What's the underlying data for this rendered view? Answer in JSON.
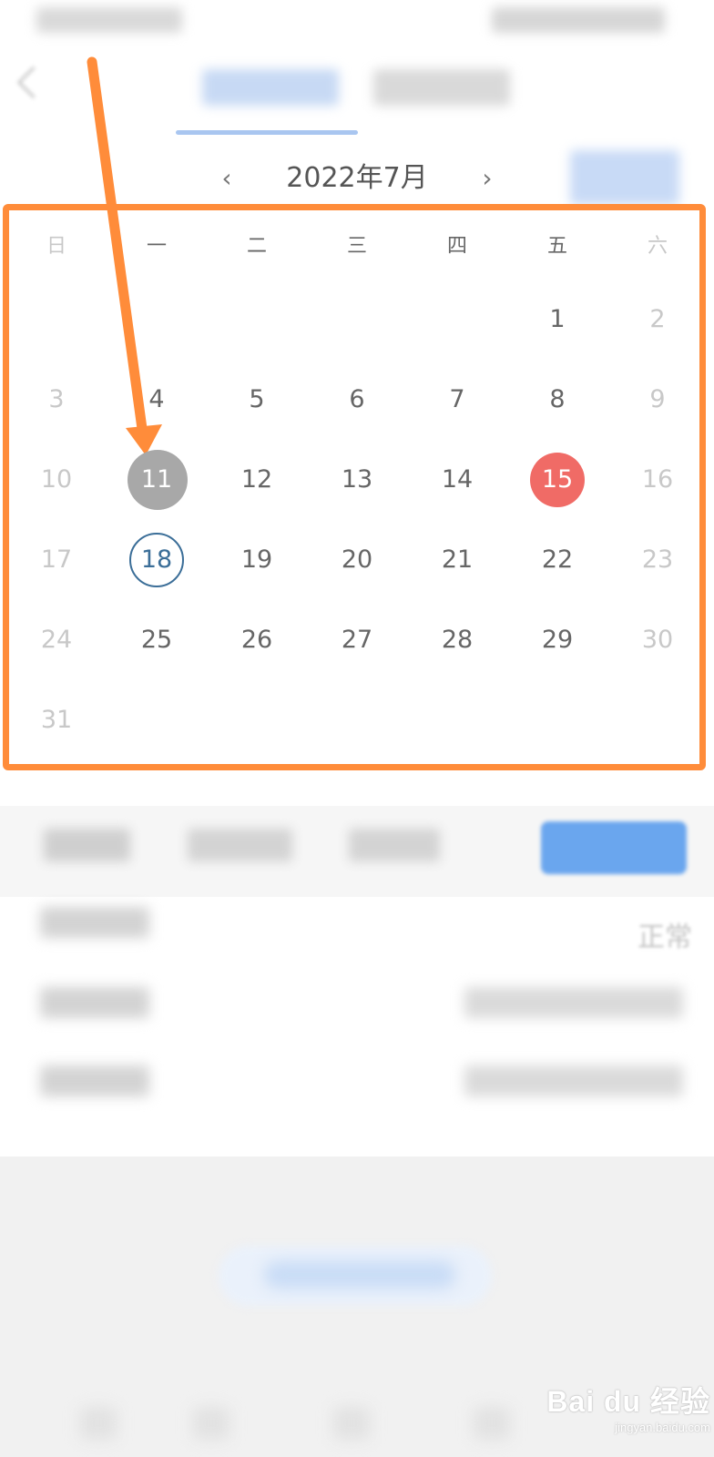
{
  "calendar": {
    "title": "2022年7月",
    "prev_icon": "‹",
    "next_icon": "›",
    "weekdays": [
      "日",
      "一",
      "二",
      "三",
      "四",
      "五",
      "六"
    ],
    "weeks": [
      [
        "",
        "",
        "",
        "",
        "",
        "1",
        "2"
      ],
      [
        "3",
        "4",
        "5",
        "6",
        "7",
        "8",
        "9"
      ],
      [
        "10",
        "11",
        "12",
        "13",
        "14",
        "15",
        "16"
      ],
      [
        "17",
        "18",
        "19",
        "20",
        "21",
        "22",
        "23"
      ],
      [
        "24",
        "25",
        "26",
        "27",
        "28",
        "29",
        "30"
      ],
      [
        "31",
        "",
        "",
        "",
        "",
        "",
        ""
      ]
    ],
    "selected_day": "11",
    "highlight_day": "15",
    "today_day": "18"
  },
  "details": {
    "status_value": "正常"
  },
  "watermark": {
    "main": "Bai du 经验",
    "sub": "jingyan.baidu.com"
  },
  "colors": {
    "annotation": "#ff8c3a",
    "selected_grey": "#a8a8a8",
    "highlight_red": "#f06b66",
    "today_blue": "#3b6e98",
    "primary_blue": "#6aa6ee"
  }
}
